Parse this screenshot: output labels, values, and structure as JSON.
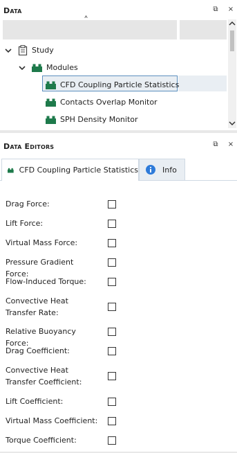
{
  "data_panel": {
    "title": "Data",
    "restore_label": "⧉",
    "close_label": "×",
    "sort_arrow": "˄",
    "tree": [
      {
        "label": "Study",
        "icon": "clipboard-icon",
        "expanded": true,
        "level": 0
      },
      {
        "label": "Modules",
        "icon": "module-icon",
        "expanded": true,
        "level": 1
      },
      {
        "label": "CFD Coupling Particle Statistics",
        "icon": "module-icon",
        "selected": true,
        "level": 2
      },
      {
        "label": "Contacts Overlap Monitor",
        "icon": "module-icon",
        "level": 2
      },
      {
        "label": "SPH Density Monitor",
        "icon": "module-icon",
        "level": 2
      }
    ]
  },
  "editors_panel": {
    "title": "Data Editors",
    "restore_label": "⧉",
    "close_label": "×",
    "tabs": [
      {
        "label": "CFD Coupling Particle Statistics",
        "icon": "module-icon",
        "active": true
      },
      {
        "label": "Info",
        "icon": "info-icon",
        "active": false
      }
    ],
    "fields": [
      {
        "label": "Drag Force:",
        "checked": false
      },
      {
        "label": "Lift Force:",
        "checked": false
      },
      {
        "label": "Virtual Mass Force:",
        "checked": false
      },
      {
        "label": "Pressure Gradient Force:",
        "checked": false
      },
      {
        "label": "Flow-Induced Torque:",
        "checked": false
      },
      {
        "label": "Convective Heat Transfer Rate:",
        "checked": false
      },
      {
        "label": "Relative Buoyancy Force:",
        "checked": false
      },
      {
        "label": "Drag Coefficient:",
        "checked": false
      },
      {
        "label": "Convective Heat Transfer Coefficient:",
        "checked": false
      },
      {
        "label": "Lift Coefficient:",
        "checked": false
      },
      {
        "label": "Virtual Mass Coefficient:",
        "checked": false
      },
      {
        "label": "Torque Coefficient:",
        "checked": false
      }
    ]
  },
  "colors": {
    "module_green": "#1e7a4b",
    "selection_bg": "#e9eef3",
    "selection_border": "#5b8fbf",
    "info_blue": "#2f7bd9"
  }
}
